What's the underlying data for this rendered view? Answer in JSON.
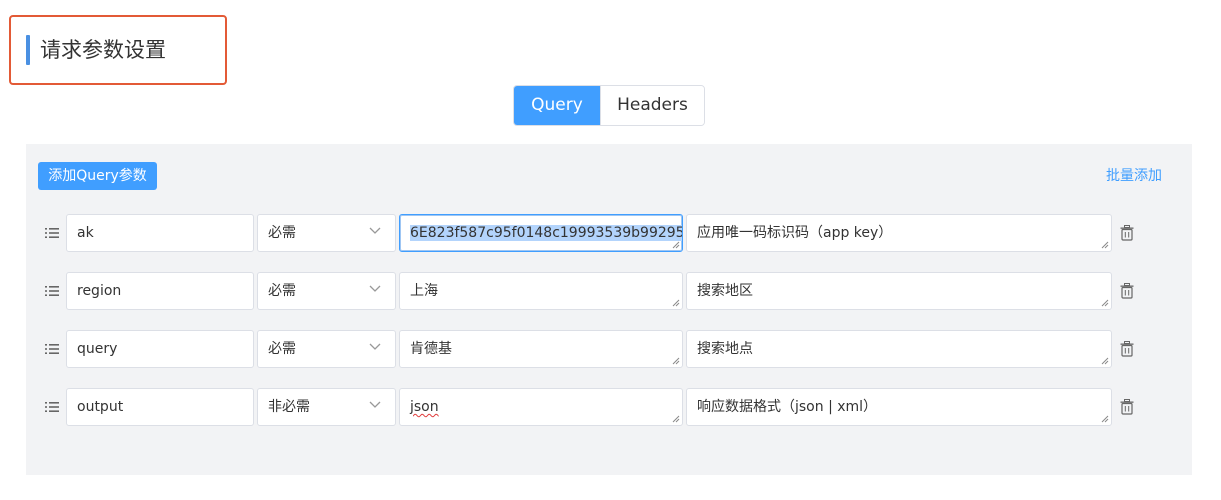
{
  "header": {
    "title": "请求参数设置"
  },
  "tabs": [
    {
      "label": "Query",
      "active": true
    },
    {
      "label": "Headers",
      "active": false
    }
  ],
  "toolbar": {
    "add_label": "添加Query参数",
    "batch_label": "批量添加"
  },
  "params": [
    {
      "name": "ak",
      "required": "必需",
      "value": "6E823f587c95f0148c19993539b99295",
      "description": "应用唯一码标识码（app key）"
    },
    {
      "name": "region",
      "required": "必需",
      "value": "上海",
      "description": "搜索地区"
    },
    {
      "name": "query",
      "required": "必需",
      "value": "肯德基",
      "description": "搜索地点"
    },
    {
      "name": "output",
      "required": "非必需",
      "value": "json",
      "description": "响应数据格式（json | xml）"
    }
  ],
  "colors": {
    "accent": "#409eff",
    "highlight_border": "#e35a36",
    "title_bar": "#4a90e2",
    "panel_bg": "#f2f3f5"
  },
  "icons": {
    "drag": "list-icon",
    "chevron": "chevron-down-icon",
    "delete": "trash-icon"
  }
}
